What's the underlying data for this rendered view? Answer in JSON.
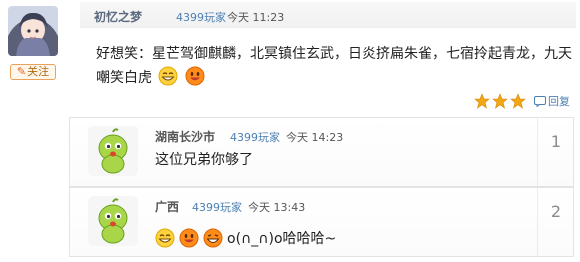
{
  "post": {
    "username": "初忆之梦",
    "badge": "4399玩家",
    "time": "今天 11:23",
    "follow_label": "关注",
    "text": "好想笑：星芒驾御麒麟，北冥镇住玄武，日炎挤扁朱雀，七宿拎起青龙，九天嘲笑白虎",
    "reply_label": "回复",
    "star_count": 3
  },
  "replies": [
    {
      "username": "湖南长沙市",
      "badge": "4399玩家",
      "time": "今天 14:23",
      "text": "这位兄弟你够了",
      "floor": "1"
    },
    {
      "username": "广西",
      "badge": "4399玩家",
      "time": "今天 13:43",
      "text": "o(∩_∩)o哈哈哈~",
      "floor": "2"
    }
  ],
  "colors": {
    "link_blue": "#4d7fb3",
    "star_gold": "#f3a712",
    "follow_orange": "#e8a25b",
    "avatar_green": "#9ccc3a"
  }
}
